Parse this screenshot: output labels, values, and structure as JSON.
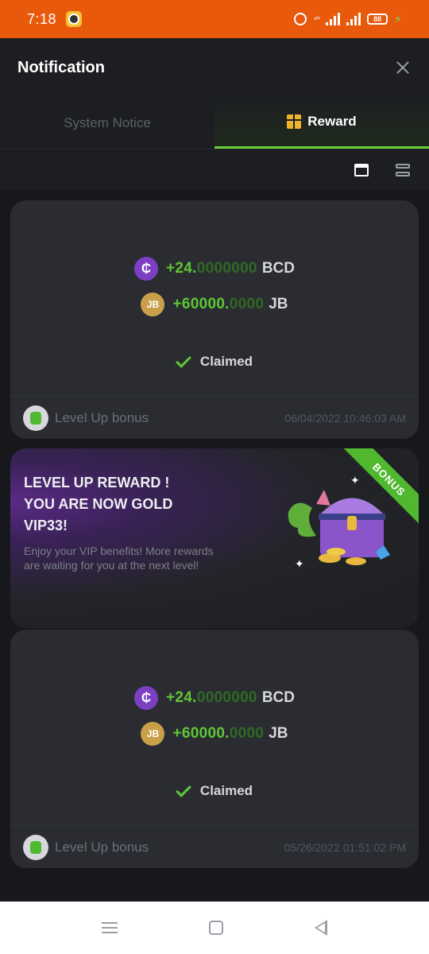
{
  "status_bar": {
    "time": "7:18",
    "battery": "88"
  },
  "header": {
    "title": "Notification"
  },
  "tabs": [
    {
      "label": "System Notice",
      "active": false
    },
    {
      "label": "Reward",
      "active": true
    }
  ],
  "cards": [
    {
      "rewards": [
        {
          "int": "+24.",
          "dec": "0000000",
          "currency": "BCD",
          "icon": "bcd-coin-icon",
          "icon_text": "₵"
        },
        {
          "int": "+60000.",
          "dec": "0000",
          "currency": "JB",
          "icon": "jb-coin-icon",
          "icon_text": "JB"
        }
      ],
      "status": "Claimed",
      "footer_label": "Level Up bonus",
      "timestamp": "06/04/2022 10:46:03 AM"
    },
    {
      "rewards": [
        {
          "int": "+24.",
          "dec": "0000000",
          "currency": "BCD",
          "icon": "bcd-coin-icon",
          "icon_text": "₵"
        },
        {
          "int": "+60000.",
          "dec": "0000",
          "currency": "JB",
          "icon": "jb-coin-icon",
          "icon_text": "JB"
        }
      ],
      "status": "Claimed",
      "footer_label": "Level Up bonus",
      "timestamp": "05/26/2022 01:51:02 PM"
    }
  ],
  "banner": {
    "title_line1": "LEVEL UP REWARD !",
    "title_line2": "YOU ARE NOW GOLD",
    "title_line3": "VIP33!",
    "description": "Enjoy your VIP benefits! More rewards are waiting for you at the next level!",
    "ribbon": "BONUS"
  },
  "colors": {
    "status_bar": "#e8590c",
    "accent_green": "#5fc735",
    "bcd_purple": "#7b3fc2",
    "jb_gold": "#c9a04a"
  }
}
